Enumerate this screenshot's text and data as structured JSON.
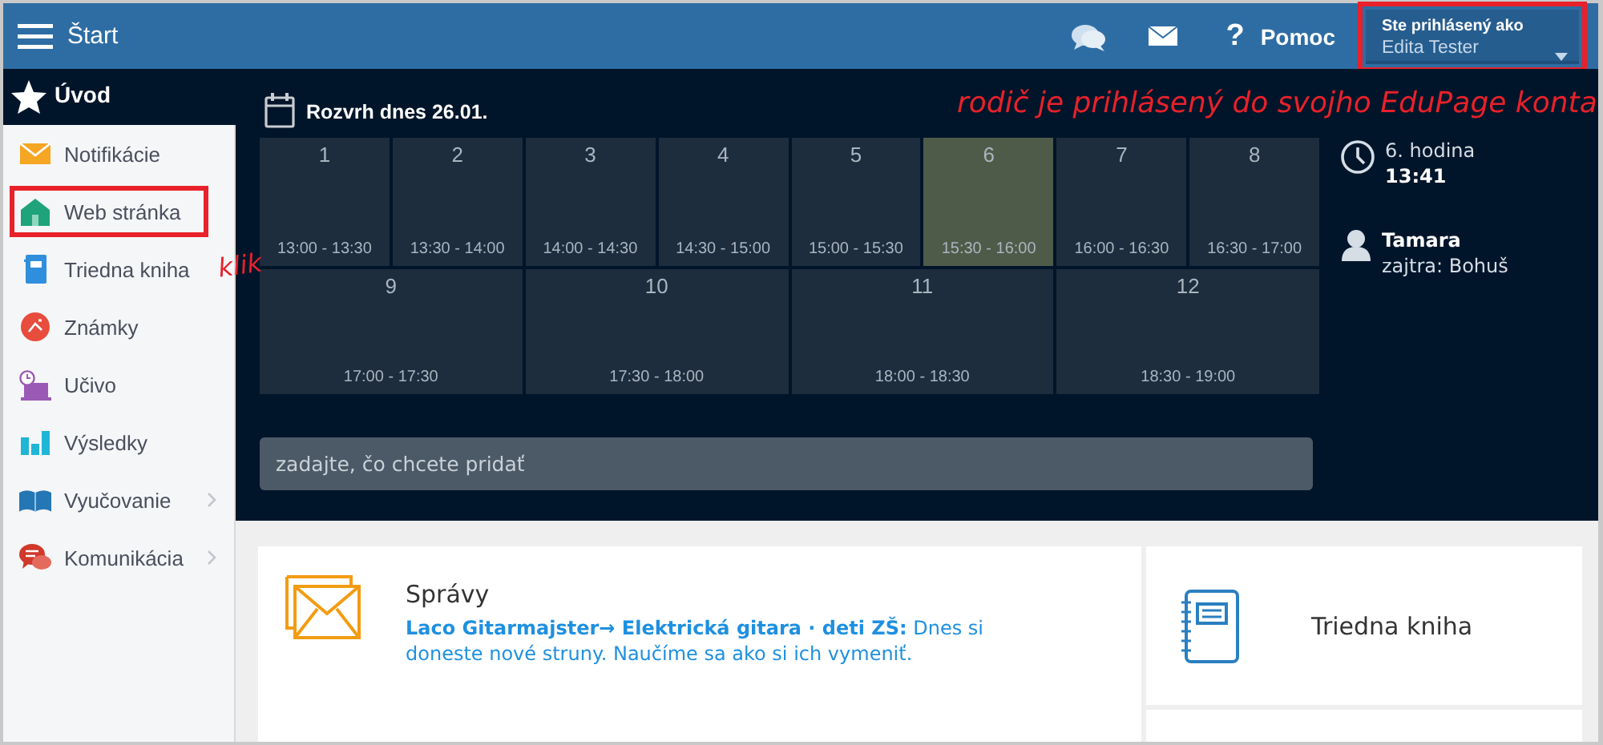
{
  "topbar": {
    "title": "Štart",
    "help": {
      "glyph": "?",
      "label": "Pomoc"
    },
    "user": {
      "caption": "Ste prihlásený ako",
      "name": "Edita Tester",
      "highlighted": true
    }
  },
  "sidebar": {
    "home": {
      "label": "Úvod"
    },
    "items": [
      {
        "label": "Notifikácie",
        "expandable": false,
        "highlighted": false
      },
      {
        "label": "Web stránka",
        "expandable": false,
        "highlighted": true
      },
      {
        "label": "Triedna kniha",
        "expandable": false,
        "highlighted": false
      },
      {
        "label": "Známky",
        "expandable": false,
        "highlighted": false
      },
      {
        "label": "Učivo",
        "expandable": false,
        "highlighted": false
      },
      {
        "label": "Výsledky",
        "expandable": false,
        "highlighted": false
      },
      {
        "label": "Vyučovanie",
        "expandable": true,
        "highlighted": false
      },
      {
        "label": "Komunikácia",
        "expandable": true,
        "highlighted": false
      }
    ]
  },
  "annotations": [
    {
      "kind": "sidebar",
      "text": "klik"
    },
    {
      "kind": "header",
      "text": "rodič je prihlásený do svojho EduPage konta"
    }
  ],
  "timetable": {
    "title": "Rozvrh dnes 26.01.",
    "rows": [
      [
        {
          "number": "1",
          "time": "13:00 - 13:30",
          "selected": false
        },
        {
          "number": "2",
          "time": "13:30 - 14:00",
          "selected": false
        },
        {
          "number": "3",
          "time": "14:00 - 14:30",
          "selected": false
        },
        {
          "number": "4",
          "time": "14:30 - 15:00",
          "selected": false
        },
        {
          "number": "5",
          "time": "15:00 - 15:30",
          "selected": false
        },
        {
          "number": "6",
          "time": "15:30 - 16:00",
          "selected": true
        },
        {
          "number": "7",
          "time": "16:00 - 16:30",
          "selected": false
        },
        {
          "number": "8",
          "time": "16:30 - 17:00",
          "selected": false
        }
      ],
      [
        {
          "number": "9",
          "time": "17:00 - 17:30",
          "selected": false
        },
        {
          "number": "10",
          "time": "17:30 - 18:00",
          "selected": false
        },
        {
          "number": "11",
          "time": "18:00 - 18:30",
          "selected": false
        },
        {
          "number": "12",
          "time": "18:30 - 19:00",
          "selected": false
        }
      ]
    ],
    "input": {
      "placeholder": "zadajte, čo chcete pridať"
    }
  },
  "info": {
    "lesson": "6. hodina",
    "time": "13:41",
    "person": "Tamara",
    "next": "zajtra: Bohuš"
  },
  "cards": {
    "messages": {
      "title": "Správy",
      "text": "**Laco Gitarmajster→ Elektrická gitara · deti ZŠ:** Dnes si doneste nové struny. Naučíme sa ako si ich vymeniť."
    },
    "classbook": {
      "title": "Triedna kniha"
    }
  }
}
